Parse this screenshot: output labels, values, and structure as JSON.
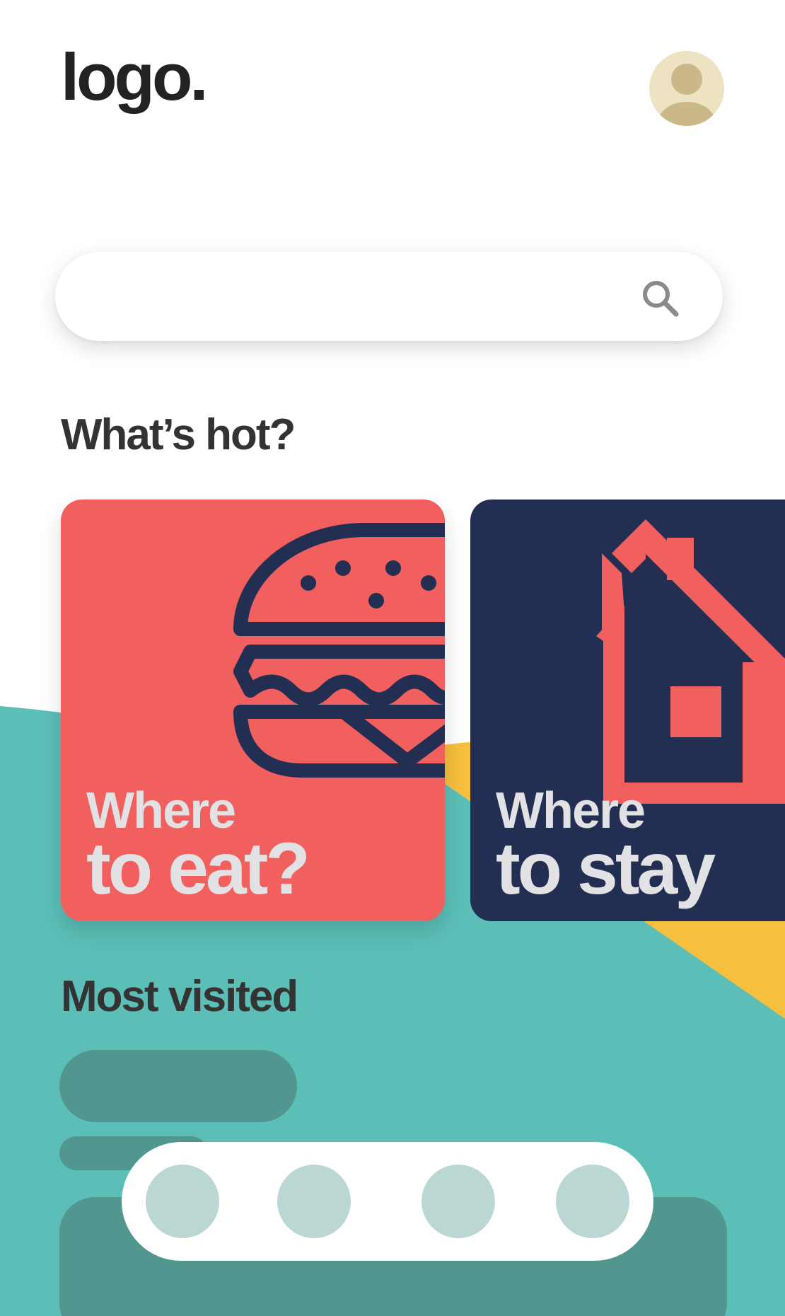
{
  "colors": {
    "teal": "#5bbfb7",
    "yellow": "#f6bf3d",
    "coral": "#f25f5f",
    "navy": "#222e52",
    "skeleton": "#51968f",
    "nav_dot": "#bbd7d3",
    "avatar_bg": "#ede2c2"
  },
  "header": {
    "logo": "logo.",
    "avatar_icon": "user-avatar-icon"
  },
  "search": {
    "value": "",
    "placeholder": "",
    "icon": "search-icon"
  },
  "hot": {
    "title": "What’s hot?",
    "cards": [
      {
        "line1": "Where",
        "line2": "to eat?",
        "icon": "burger-icon",
        "color": "#f25f5f"
      },
      {
        "line1": "Where",
        "line2": "to stay",
        "icon": "house-icon",
        "color": "#222e52"
      }
    ]
  },
  "most_visited": {
    "title": "Most visited"
  },
  "bottom_nav": {
    "items": [
      "nav-item-1",
      "nav-item-2",
      "nav-item-3",
      "nav-item-4"
    ]
  }
}
